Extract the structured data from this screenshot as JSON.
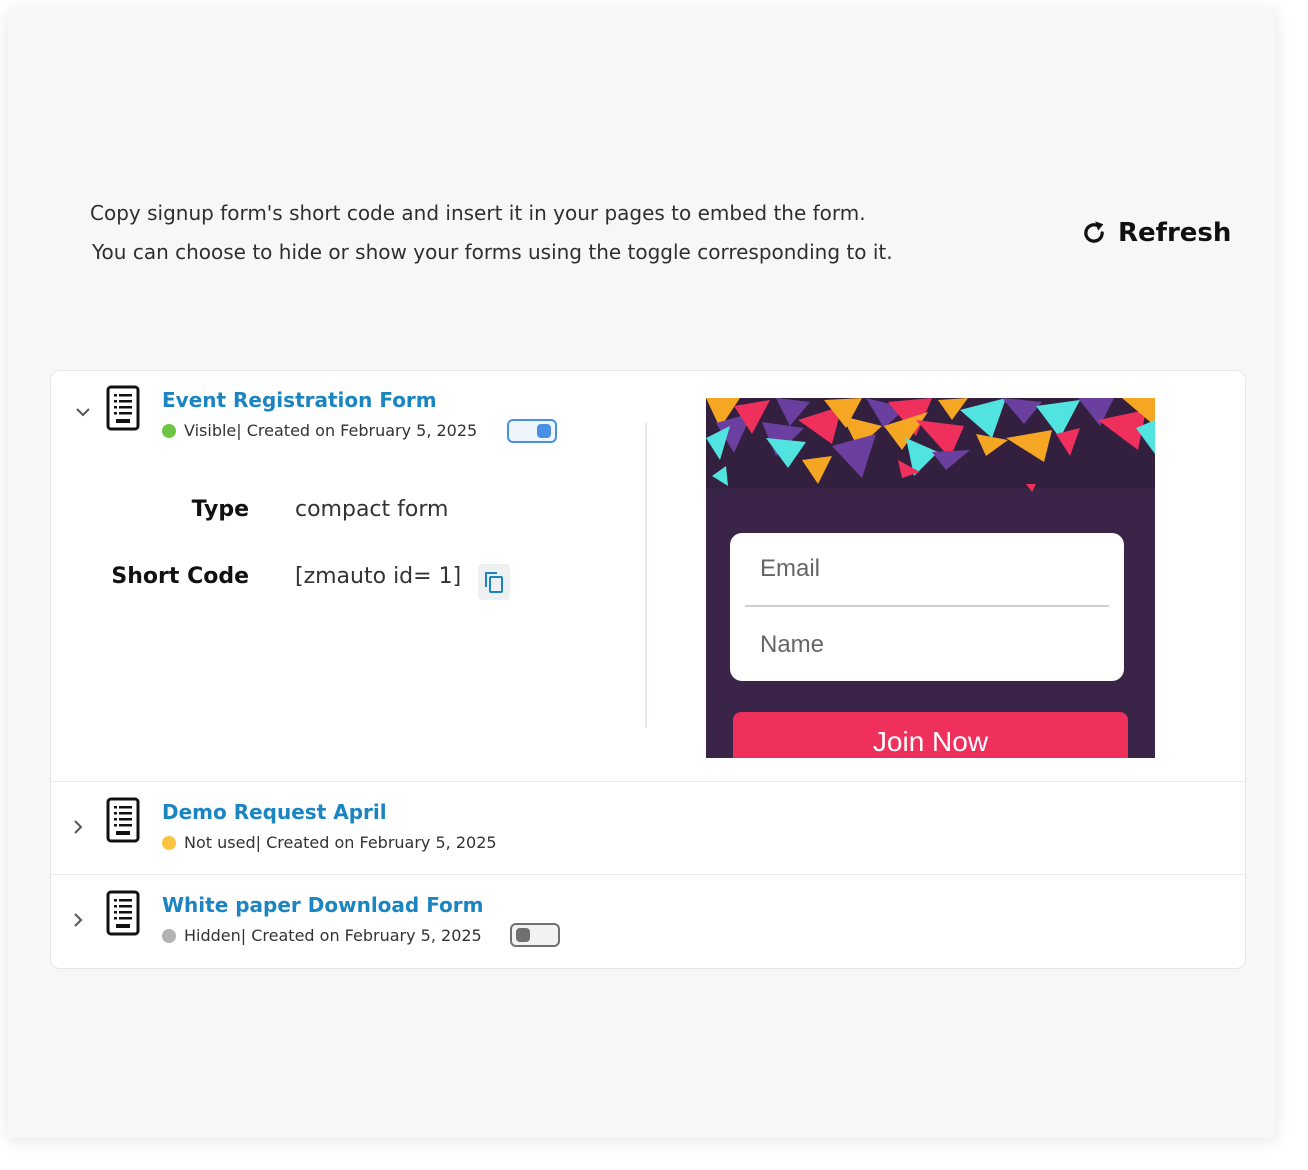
{
  "instructions": {
    "line1": "Copy signup form's short code and insert it in your pages to embed the form.",
    "line2": "You can choose to hide or show your forms using the toggle corresponding to it."
  },
  "refresh": {
    "label": "Refresh",
    "icon": "refresh-icon"
  },
  "forms": [
    {
      "title": "Event Registration Form",
      "status": "Visible",
      "status_color": "#6cc644",
      "created": " | Created on February 5, 2025",
      "expanded": true,
      "toggle_on": true,
      "details": {
        "type_label": "Type",
        "type_value": "compact form",
        "shortcode_label": "Short Code",
        "shortcode_value": "[zmauto id= 1]"
      },
      "preview": {
        "email_placeholder": "Email",
        "name_placeholder": "Name",
        "button_label": "Join Now",
        "background": "#3a2447",
        "button_color": "#ef2f5c"
      }
    },
    {
      "title": "Demo Request April",
      "status": "Not used",
      "status_color": "#f9c440",
      "created": " | Created on February 5, 2025",
      "expanded": false
    },
    {
      "title": "White paper Download Form",
      "status": "Hidden",
      "status_color": "#b3b3b3",
      "created": " | Created on February 5, 2025",
      "expanded": false,
      "toggle_on": false
    }
  ],
  "colors": {
    "accent": "#1a85c1",
    "toggle_on": "#4a90e2",
    "toggle_off": "#707070"
  }
}
